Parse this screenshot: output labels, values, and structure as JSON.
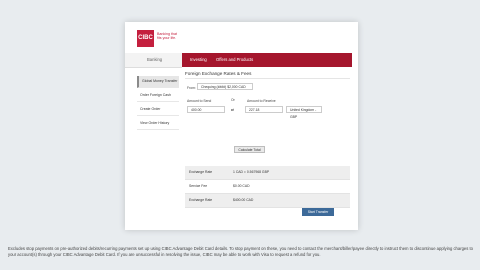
{
  "brand": {
    "name": "CIBC",
    "tagline": "Banking that fits your life."
  },
  "nav": {
    "left_item": "Banking",
    "items": [
      "Investing",
      "Offers and Products"
    ]
  },
  "sidebar": {
    "items": [
      "Global Money Transfer",
      "Order Foreign Cash",
      "Create Order",
      "View Order History"
    ]
  },
  "form": {
    "title": "Foreign Exchange Rates & Fees",
    "from_label": "From:",
    "from_value": "Chequing (####) $2,000 CAD",
    "send_label": "Amount to Send",
    "send_value": "400.00",
    "or_label": "Or",
    "receive_label": "Amount to Receive",
    "receive_value": "227.18",
    "currency_value": "United Kingdom - GBP",
    "arrow": "⇄",
    "calc_button": "Calculate Total"
  },
  "results": [
    {
      "label": "Exchange Rate",
      "value": "1 CAD = 0.567968 GBP"
    },
    {
      "label": "Service Fee",
      "value": "$0.00 CAD"
    },
    {
      "label": "Exchange Rate",
      "value": "$400.00 CAD"
    }
  ],
  "start_button": "Start Transfer",
  "caption": "Excludes stop payments on pre-authorized debits/recurring payments set up using CIBC Advantage Debit Card details. To stop payment on these, you need to contact the merchant/biller/payee directly to instruct them to discontinue applying charges to your account(s) through your CIBC Advantage Debit Card. If you are unsuccessful in resolving the issue, CIBC may be able to work with Visa to request a refund for you."
}
